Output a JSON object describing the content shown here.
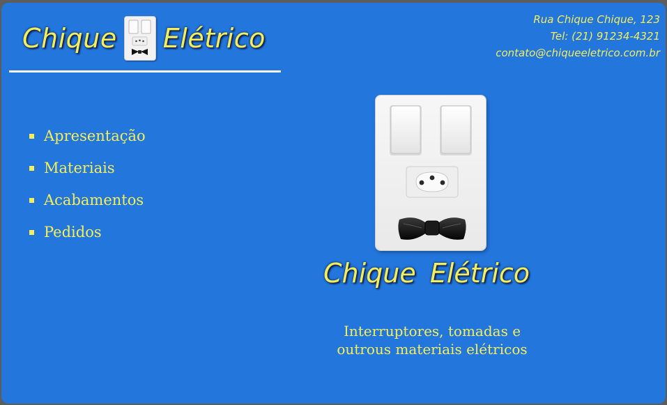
{
  "brand": {
    "name_left": "Chique",
    "name_right": "Elétrico",
    "hero_title": "Chique  Elétrico",
    "logo_icon": "switch-plate-bowtie-icon",
    "accent_color": "#f5ee5c",
    "background_color": "#2276dc"
  },
  "contact": {
    "address": "Rua Chique Chique, 123",
    "phone": "Tel: (21) 91234-4321",
    "email": "contato@chiqueeletrico.com.br"
  },
  "nav": {
    "items": [
      {
        "label": "Apresentação"
      },
      {
        "label": "Materiais"
      },
      {
        "label": "Acabamentos"
      },
      {
        "label": "Pedidos"
      }
    ]
  },
  "hero": {
    "tagline_line1": "Interruptores, tomadas e",
    "tagline_line2": "outrous materiais elétricos"
  }
}
